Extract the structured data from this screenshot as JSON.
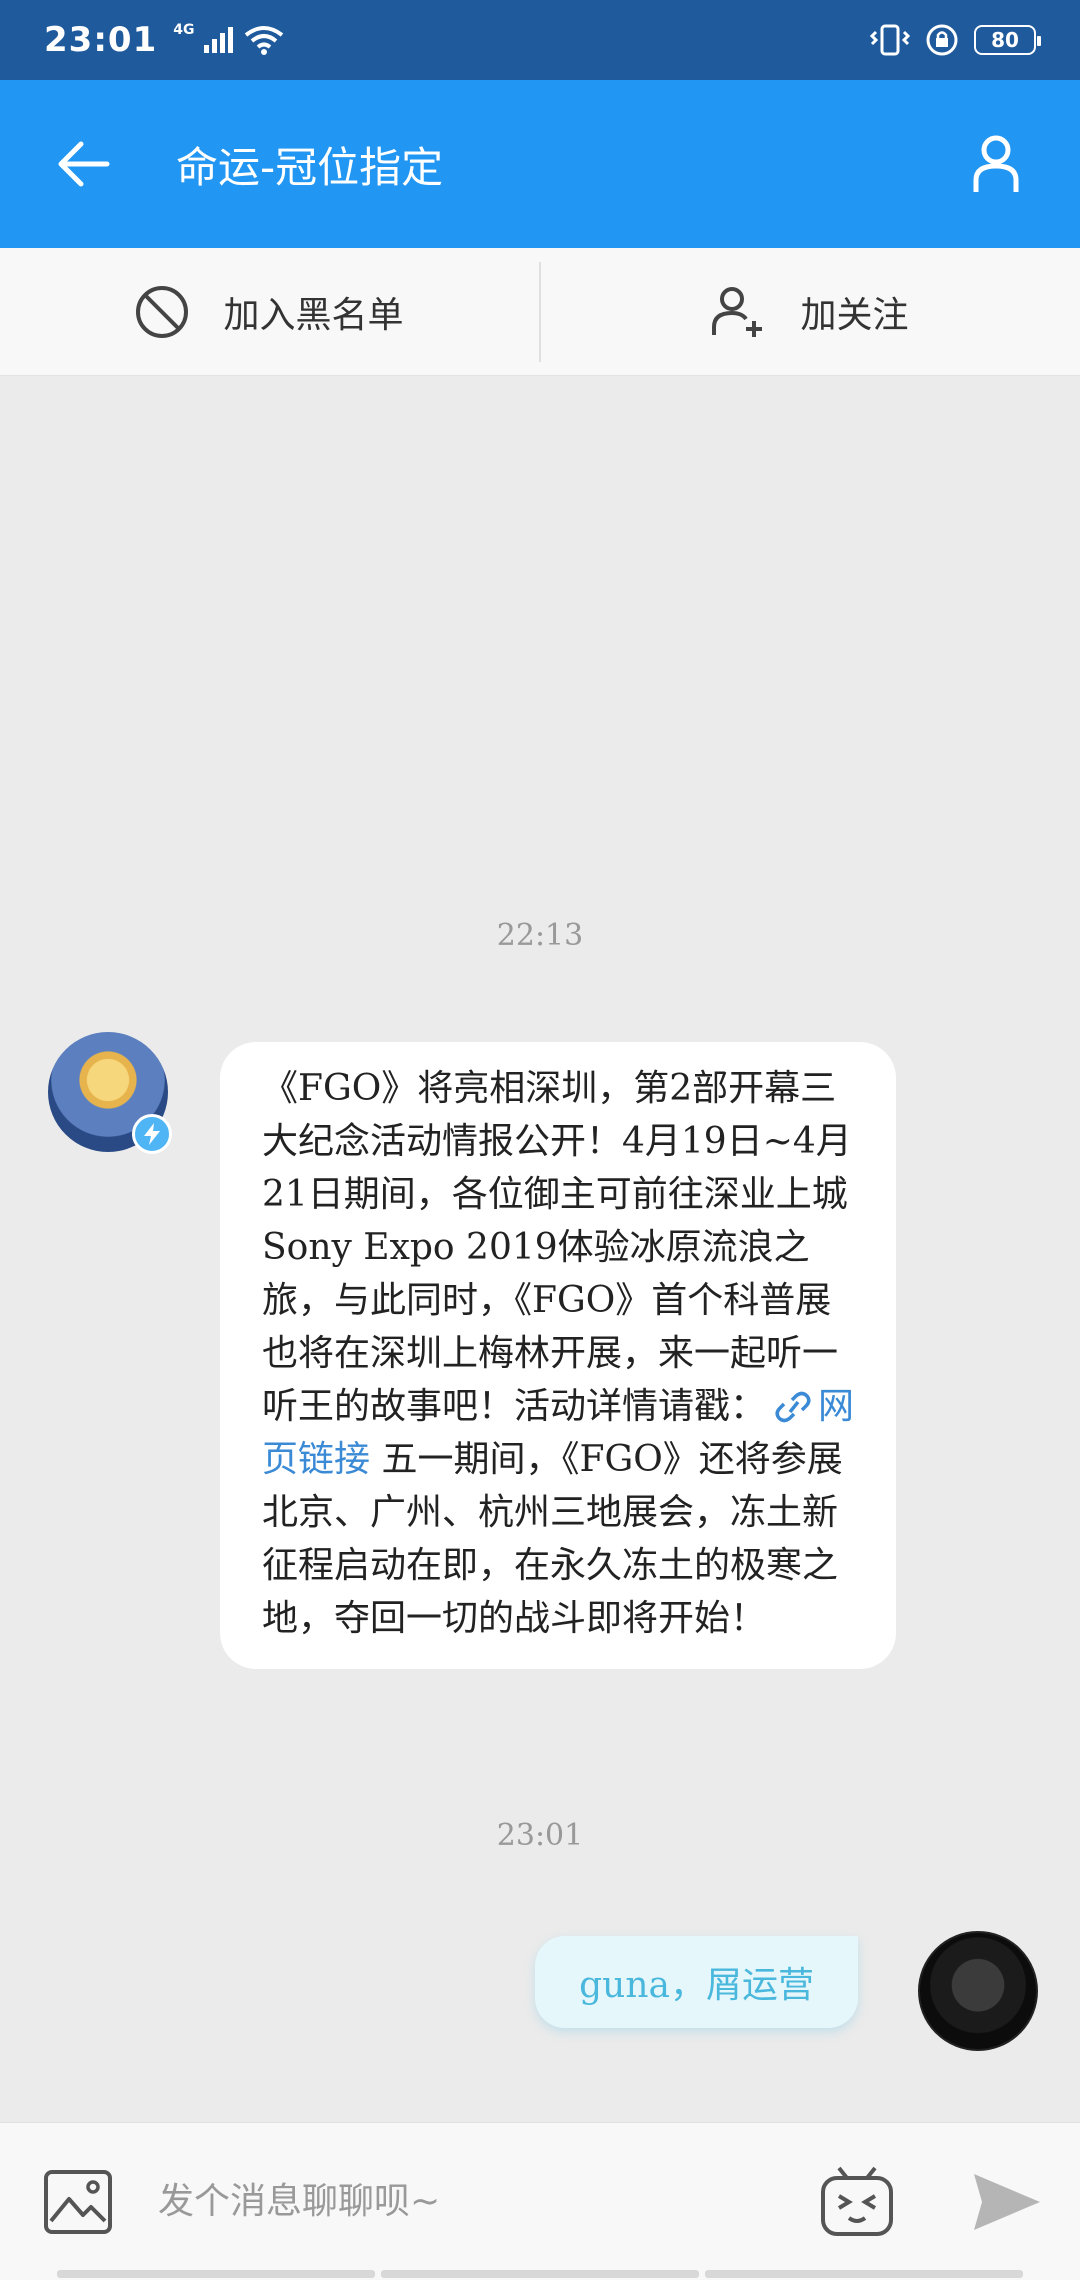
{
  "status_bar": {
    "time": "23:01",
    "network": "4G",
    "battery": "80",
    "icons": [
      "signal-icon",
      "wifi-icon",
      "vibrate-icon",
      "lock-icon",
      "battery-icon"
    ]
  },
  "app_bar": {
    "title": "命运-冠位指定",
    "icons": [
      "back-arrow-icon",
      "profile-icon"
    ]
  },
  "actions": {
    "blacklist_label": "加入黑名单",
    "follow_label": "加关注"
  },
  "chat": {
    "timestamp_1": "22:13",
    "timestamp_2": "23:01",
    "incoming": {
      "text_before": "《FGO》将亮相深圳，第2部开幕三大纪念活动情报公开！4月19日~4月21日期间，各位御主可前往深业上城Sony Expo 2019体验冰原流浪之旅，与此同时，《FGO》首个科普展也将在深圳上梅林开展，来一起听一听王的故事吧！活动详情请戳：",
      "link_text": "网页链接",
      "text_after": "五一期间，《FGO》还将参展北京、广州、杭州三地展会，冻土新征程启动在即，在永久冻土的极寒之地，夺回一切的战斗即将开始！"
    },
    "outgoing": {
      "text": "guna，屑运营"
    }
  },
  "input": {
    "placeholder": "发个消息聊聊呗~",
    "icons": [
      "image-icon",
      "emoji-icon",
      "send-icon"
    ]
  },
  "colors": {
    "status_bar": "#1e5a9c",
    "app_bar": "#2196f3",
    "link": "#3a8ad6",
    "outgoing_text": "#4ab8dc"
  }
}
